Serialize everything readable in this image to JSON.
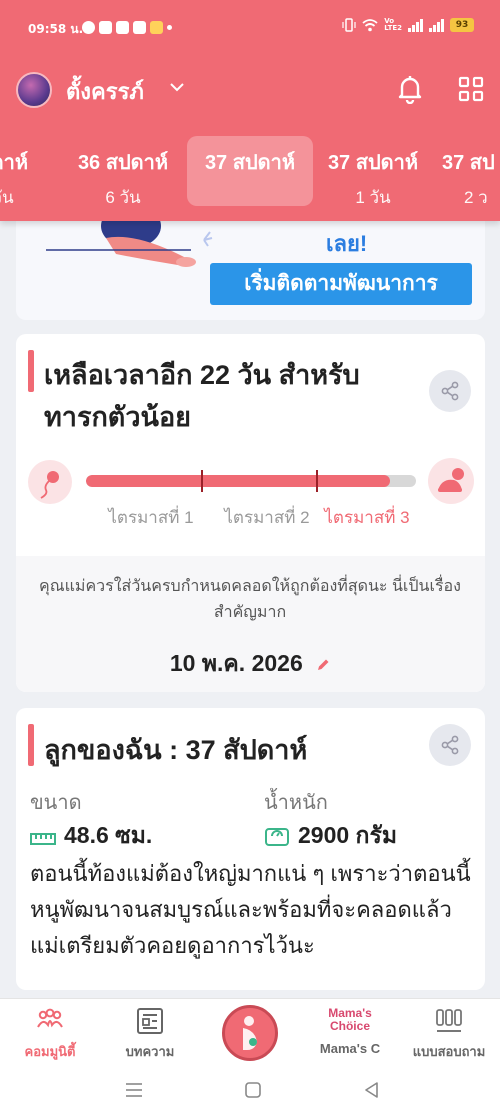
{
  "status_bar": {
    "time": "09:58 น.",
    "battery": "93",
    "network": "Vo LTE2"
  },
  "header": {
    "app_name": "ตั้งครรภ์",
    "weeks": [
      {
        "week": "ปดาห์",
        "day": "วัน"
      },
      {
        "week": "36 สปดาห์",
        "day": "6 วัน"
      },
      {
        "week": "37 สปดาห์",
        "day": ""
      },
      {
        "week": "37 สปดาห์",
        "day": "1 วัน"
      },
      {
        "week": "37 สป",
        "day": "2 ว"
      }
    ]
  },
  "development_card": {
    "lets_text": "เลย!",
    "track_button": "เริ่มติดตามพัฒนาการ"
  },
  "countdown_card": {
    "title": "เหลือเวลาอีก 22 วัน สำหรับทารกตัวน้อย",
    "progress_percent": 92,
    "trimesters": [
      "ไตรมาสที่ 1",
      "ไตรมาสที่ 2",
      "ไตรมาสที่ 3"
    ],
    "note": "คุณแม่ควรใส่วันครบกำหนดคลอดให้ถูกต้องที่สุดนะ นี่เป็นเรื่องสำคัญมาก",
    "due_date": "10 พ.ค. 2026"
  },
  "baby_card": {
    "title": "ลูกของฉัน :  37 สัปดาห์",
    "size_label": "ขนาด",
    "size_value": "48.6 ซม.",
    "weight_label": "น้ำหนัก",
    "weight_value": "2900 กรัม",
    "description": "ตอนนี้ท้องแม่ต้องใหญ่มากแน่ ๆ เพราะว่าตอนนี้หนูพัฒนาจนสมบูรณ์และพร้อมที่จะคลอดแล้ว แม่เตรียมตัวคอยดูอาการไว้นะ"
  },
  "bottom_nav": {
    "items": [
      {
        "label": "คอมมูนิตี้",
        "icon": "community-icon"
      },
      {
        "label": "บทความ",
        "icon": "article-icon"
      },
      {
        "label": "",
        "icon": "pregnancy-fab-icon"
      },
      {
        "label": "Mama's C",
        "icon": "mamas-choice-logo",
        "logo_line1": "Mama's",
        "logo_line2": "Chöice"
      },
      {
        "label": "แบบสอบถาม",
        "icon": "survey-icon"
      }
    ]
  },
  "colors": {
    "accent": "#f06a74",
    "button_blue": "#2b95e8",
    "link_blue": "#2b7de0"
  }
}
